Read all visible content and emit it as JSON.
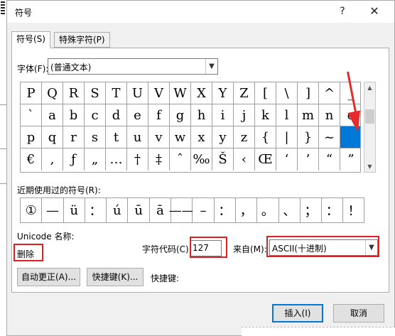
{
  "window": {
    "title": "符号",
    "help": "?",
    "close": "✕"
  },
  "tabs": [
    {
      "label": "符号(S)"
    },
    {
      "label": "特殊字符(P)"
    }
  ],
  "font": {
    "label": "字体(F):",
    "value": "(普通文本)"
  },
  "symbols": [
    "P",
    "Q",
    "R",
    "S",
    "T",
    "U",
    "V",
    "W",
    "X",
    "Y",
    "Z",
    "[",
    "\\",
    "]",
    "^",
    "_",
    "`",
    "a",
    "b",
    "c",
    "d",
    "e",
    "f",
    "g",
    "h",
    "i",
    "j",
    "k",
    "l",
    "m",
    "n",
    "o",
    "p",
    "q",
    "r",
    "s",
    "t",
    "u",
    "v",
    "w",
    "x",
    "y",
    "z",
    "{",
    "|",
    "}",
    "~",
    "",
    "€",
    ",",
    "ƒ",
    "„",
    "…",
    "†",
    "‡",
    "ˆ",
    "‰",
    "Š",
    "‹",
    "Œ",
    "‘",
    "’",
    "“",
    "”"
  ],
  "recent": {
    "label": "近期使用过的符号(R):",
    "items": [
      "①",
      "—",
      "ü",
      "：",
      "ú",
      "ū",
      "ā",
      "——",
      "–",
      "：",
      "，",
      "。",
      "、",
      "；",
      "：",
      "！"
    ]
  },
  "unicode": {
    "label": "Unicode 名称:",
    "value": "删除"
  },
  "char_code": {
    "label": "字符代码(C):",
    "value": "127"
  },
  "from": {
    "label": "来自(M):",
    "value": "ASCII(十进制)"
  },
  "buttons": {
    "autocorrect": "自动更正(A)...",
    "shortcut": "快捷键(K)...",
    "shortcut_label": "快捷键:",
    "insert": "插入(I)",
    "cancel": "取消"
  },
  "scroll": {
    "up": "▲",
    "down": "▼",
    "dropdown": "▼"
  }
}
